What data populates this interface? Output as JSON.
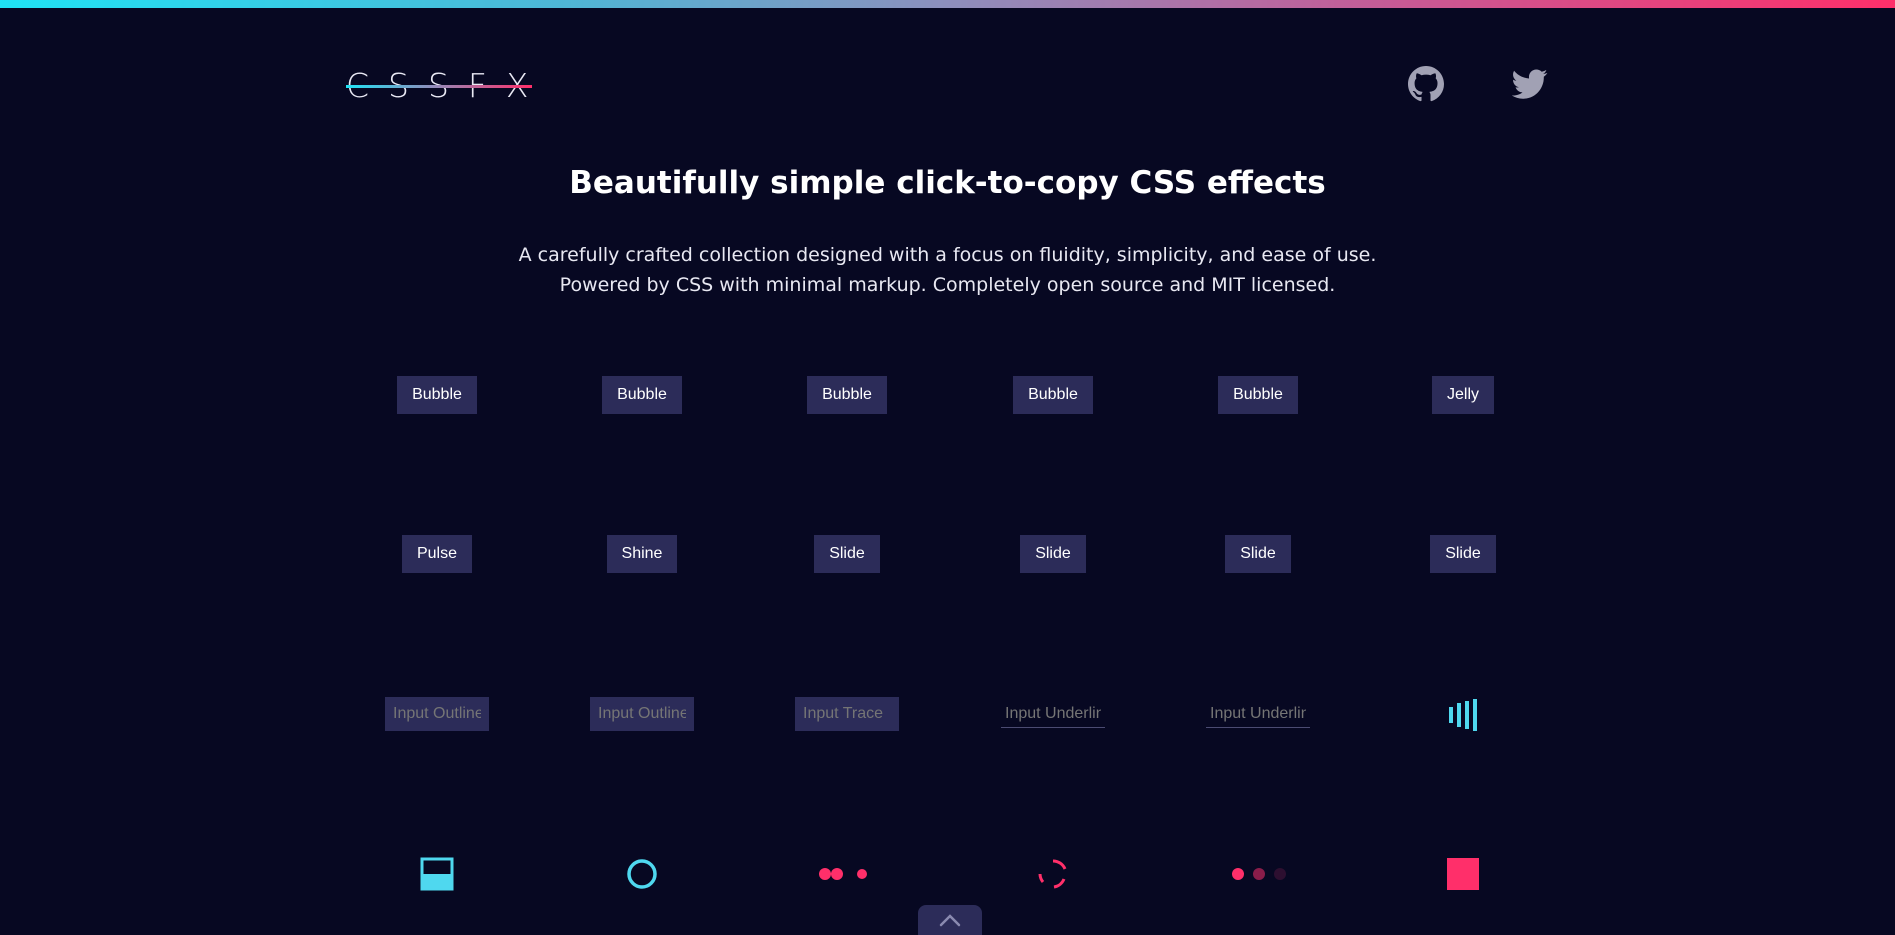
{
  "header": {
    "logo_text": "CSSFX",
    "github_icon": "github-icon",
    "twitter_icon": "twitter-icon"
  },
  "hero": {
    "title": "Beautifully simple click-to-copy CSS effects",
    "subtitle_line1": "A carefully crafted collection designed with a focus on fluidity, simplicity, and ease of use.",
    "subtitle_line2": "Powered by CSS with minimal markup. Completely open source and MIT licensed."
  },
  "effects": {
    "row1": [
      "Bubble",
      "Bubble",
      "Bubble",
      "Bubble",
      "Bubble",
      "Jelly"
    ],
    "row2": [
      "Pulse",
      "Shine",
      "Slide",
      "Slide",
      "Slide",
      "Slide"
    ],
    "row3": [
      {
        "placeholder": "Input Outline"
      },
      {
        "placeholder": "Input Outline"
      },
      {
        "placeholder": "Input Trace"
      },
      {
        "placeholder": "Input Underline"
      },
      {
        "placeholder": "Input Underline"
      }
    ],
    "row3_loader_icon": "bars-loader-icon",
    "row4_icons": [
      "fill-square-loader-icon",
      "ring-loader-icon",
      "dots-loader-icon",
      "spinner-loader-icon",
      "fading-dots-loader-icon",
      "square-loader-icon"
    ]
  },
  "scroll_top": {
    "icon": "chevron-up-icon"
  },
  "colors": {
    "background": "#070822",
    "button": "#2c2c59",
    "cyan": "#4fd8ef",
    "pink": "#ff2f6a"
  }
}
